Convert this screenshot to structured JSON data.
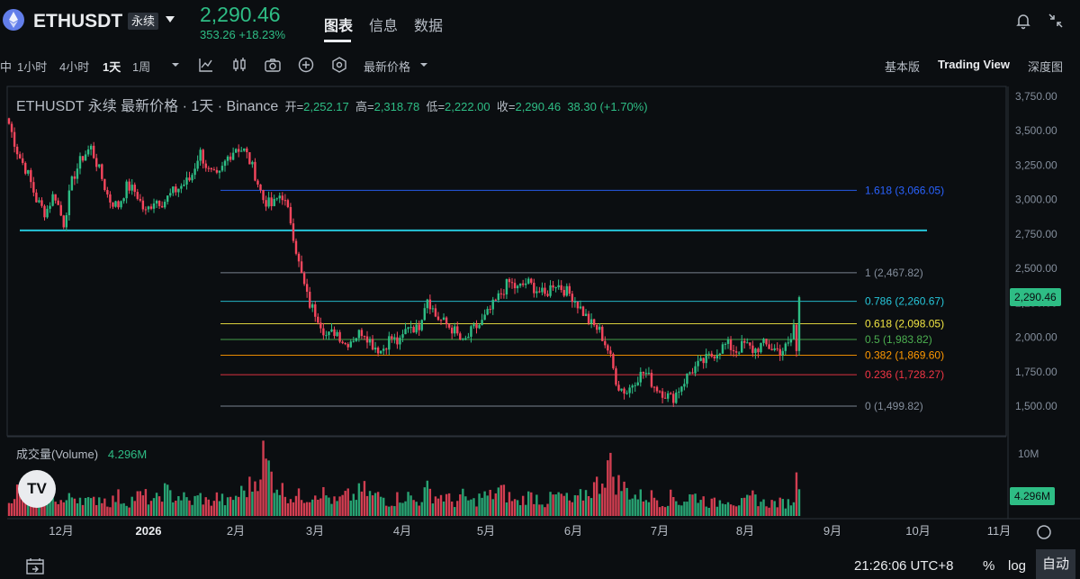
{
  "header": {
    "symbol": "ETHUSDT",
    "contract_badge": "永续",
    "price": "2,290.46",
    "change": "353.26 +18.23%",
    "tabs": [
      {
        "label": "图表",
        "active": true
      },
      {
        "label": "信息",
        "active": false
      },
      {
        "label": "数据",
        "active": false
      }
    ],
    "icons": [
      "ethereum-logo-icon",
      "chevron-down-icon",
      "bell-icon",
      "collapse-icon"
    ]
  },
  "toolbar": {
    "intervals": [
      {
        "label": "中",
        "active": false
      },
      {
        "label": "1小时",
        "active": false
      },
      {
        "label": "4小时",
        "active": false
      },
      {
        "label": "1天",
        "active": true
      },
      {
        "label": "1周",
        "active": false
      }
    ],
    "price_type": "最新价格",
    "views": [
      {
        "label": "基本版",
        "active": false
      },
      {
        "label": "Trading View",
        "active": true
      },
      {
        "label": "深度图",
        "active": false
      }
    ]
  },
  "legend": {
    "title": "ETHUSDT 永续 最新价格 · 1天 · Binance",
    "open_label": "开=",
    "open": "2,252.17",
    "high_label": "高=",
    "high": "2,318.78",
    "low_label": "低=",
    "low": "2,222.00",
    "close_label": "收=",
    "close": "2,290.46",
    "change": "38.30 (+1.70%)",
    "volume_label": "成交量(Volume)",
    "volume_value": "4.296M"
  },
  "bottom": {
    "time": "21:26:06 UTC+8",
    "percent": "%",
    "log": "log",
    "auto": "自动"
  },
  "colors": {
    "up": "#2ebd85",
    "down": "#f6465d",
    "background": "#0b0e11",
    "accent_line": "#26c6da"
  },
  "chart_data": {
    "type": "candlestick",
    "interval": "1天",
    "y_ticks": [
      "3,750.00",
      "3,500.00",
      "3,250.00",
      "3,000.00",
      "2,750.00",
      "2,500.00",
      "2,250.00",
      "2,000.00",
      "1,750.00",
      "1,500.00"
    ],
    "y_tick_values": [
      3750,
      3500,
      3250,
      3000,
      2750,
      2500,
      2250,
      2000,
      1750,
      1500
    ],
    "ylim": [
      1400,
      3800
    ],
    "x_ticks": [
      "12月",
      "2026",
      "2月",
      "3月",
      "4月",
      "5月",
      "6月",
      "7月",
      "8月",
      "9月",
      "10月",
      "11月"
    ],
    "last_price": "2,290.46",
    "last_price_value": 2290.46,
    "volume_axis_label": "10M",
    "volume_axis_value": 10,
    "volume_last_label": "4.296M",
    "volume_last_value": 4.296,
    "horizontal_line": {
      "value": 2775,
      "color": "#26c6da"
    },
    "fibonacci": [
      {
        "label": "1.618 (3,066.05)",
        "value": 3066.05,
        "color": "#2962ff"
      },
      {
        "label": "1 (2,467.82)",
        "value": 2467.82,
        "color": "#848e9c"
      },
      {
        "label": "0.786 (2,260.67)",
        "value": 2260.67,
        "color": "#26c6da"
      },
      {
        "label": "0.618 (2,098.05)",
        "value": 2098.05,
        "color": "#f0e442"
      },
      {
        "label": "0.5 (1,983.82)",
        "value": 1983.82,
        "color": "#4caf50"
      },
      {
        "label": "0.382 (1,869.60)",
        "value": 1869.6,
        "color": "#ff9800"
      },
      {
        "label": "0.236 (1,728.27)",
        "value": 1728.27,
        "color": "#f23645"
      },
      {
        "label": "0 (1,499.82)",
        "value": 1499.82,
        "color": "#848e9c"
      }
    ],
    "close_path": [
      3550,
      3330,
      3200,
      3000,
      2900,
      3050,
      2820,
      3150,
      3300,
      3380,
      3200,
      3000,
      2950,
      3100,
      3050,
      2900,
      3000,
      2980,
      3050,
      3100,
      3150,
      3350,
      3200,
      3150,
      3300,
      3380,
      3350,
      3200,
      3000,
      2950,
      3050,
      2850,
      2500,
      2250,
      2150,
      2000,
      2050,
      1950,
      2000,
      2050,
      1950,
      1900,
      2000,
      1950,
      2100,
      2050,
      2300,
      2150,
      2100,
      2050,
      1950,
      2050,
      2100,
      2200,
      2300,
      2400,
      2350,
      2400,
      2350,
      2300,
      2400,
      2350,
      2300,
      2200,
      2100,
      2050,
      1900,
      1650,
      1600,
      1700,
      1750,
      1650,
      1600,
      1550,
      1650,
      1750,
      1800,
      1850,
      1900,
      1950,
      1900,
      1950,
      1900,
      1950,
      1920,
      1900,
      1950,
      2300
    ],
    "volume_path": [
      3,
      4,
      2,
      3,
      4,
      3,
      2,
      3,
      3,
      2,
      3,
      2,
      3,
      2,
      3,
      3,
      2,
      4,
      3,
      3,
      2,
      3,
      2,
      3,
      2,
      3,
      4,
      5,
      9,
      6,
      4,
      3,
      3,
      3,
      4,
      3,
      2,
      3,
      3,
      4,
      3,
      3,
      2,
      3,
      3,
      2,
      4,
      3,
      3,
      2,
      3,
      2,
      3,
      3,
      4,
      3,
      2,
      3,
      3,
      2,
      3,
      3,
      2,
      3,
      4,
      5,
      8,
      5,
      4,
      3,
      3,
      3,
      2,
      3,
      2,
      3,
      3,
      2,
      2,
      3,
      2,
      2,
      3,
      2,
      2,
      2,
      2,
      4.3
    ]
  }
}
